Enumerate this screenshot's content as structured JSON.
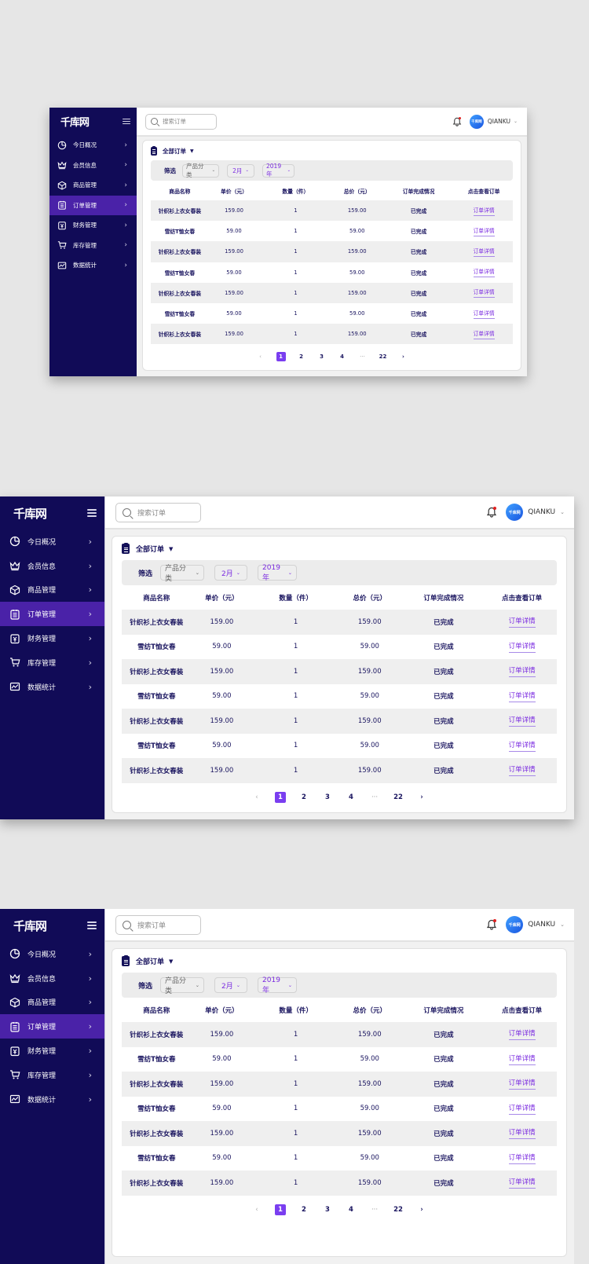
{
  "app": {
    "logo": "千库网",
    "menu": [
      {
        "label": "今日概况",
        "icon": "pie-chart-icon"
      },
      {
        "label": "会员信息",
        "icon": "crown-icon"
      },
      {
        "label": "商品管理",
        "icon": "box-icon"
      },
      {
        "label": "订单管理",
        "icon": "order-list-icon",
        "active": true
      },
      {
        "label": "财务管理",
        "icon": "finance-icon"
      },
      {
        "label": "库存管理",
        "icon": "cart-icon"
      },
      {
        "label": "数据统计",
        "icon": "line-chart-icon"
      }
    ],
    "search": {
      "placeholder": "搜索订单"
    },
    "user": {
      "name": "QIANKU",
      "avatar_text": "千库网",
      "notification_dot_color": "#e02020"
    },
    "card": {
      "title": "全部订单",
      "filter_label": "筛选",
      "filters": [
        {
          "value": "产品分类",
          "tone": "grey"
        },
        {
          "value": "2月",
          "tone": "purple"
        },
        {
          "value": "2019年",
          "tone": "purple"
        }
      ]
    },
    "table": {
      "columns": [
        "商品名称",
        "单价（元）",
        "数量（件）",
        "总价（元）",
        "订单完成情况",
        "点击查看订单"
      ],
      "rows": [
        {
          "name": "针织衫上衣女春装",
          "price": "159.00",
          "qty": "1",
          "total": "159.00",
          "status": "已完成",
          "action": "订单详情"
        },
        {
          "name": "雪纺T恤女春",
          "price": "59.00",
          "qty": "1",
          "total": "59.00",
          "status": "已完成",
          "action": "订单详情"
        },
        {
          "name": "针织衫上衣女春装",
          "price": "159.00",
          "qty": "1",
          "total": "159.00",
          "status": "已完成",
          "action": "订单详情"
        },
        {
          "name": "雪纺T恤女春",
          "price": "59.00",
          "qty": "1",
          "total": "59.00",
          "status": "已完成",
          "action": "订单详情"
        },
        {
          "name": "针织衫上衣女春装",
          "price": "159.00",
          "qty": "1",
          "total": "159.00",
          "status": "已完成",
          "action": "订单详情"
        },
        {
          "name": "雪纺T恤女春",
          "price": "59.00",
          "qty": "1",
          "total": "59.00",
          "status": "已完成",
          "action": "订单详情"
        },
        {
          "name": "针织衫上衣女春装",
          "price": "159.00",
          "qty": "1",
          "total": "159.00",
          "status": "已完成",
          "action": "订单详情"
        }
      ]
    },
    "pagination": {
      "prev": "‹",
      "pages": [
        "1",
        "2",
        "3",
        "4",
        "···",
        "22"
      ],
      "current": "1",
      "next": "›"
    }
  },
  "colors": {
    "sidebar_bg": "#110b57",
    "active_item": "#4a22a8",
    "accent": "#7a2ae0",
    "page_bg": "#e6e6e6"
  },
  "variants": [
    "small",
    "large",
    "large-cropped"
  ]
}
